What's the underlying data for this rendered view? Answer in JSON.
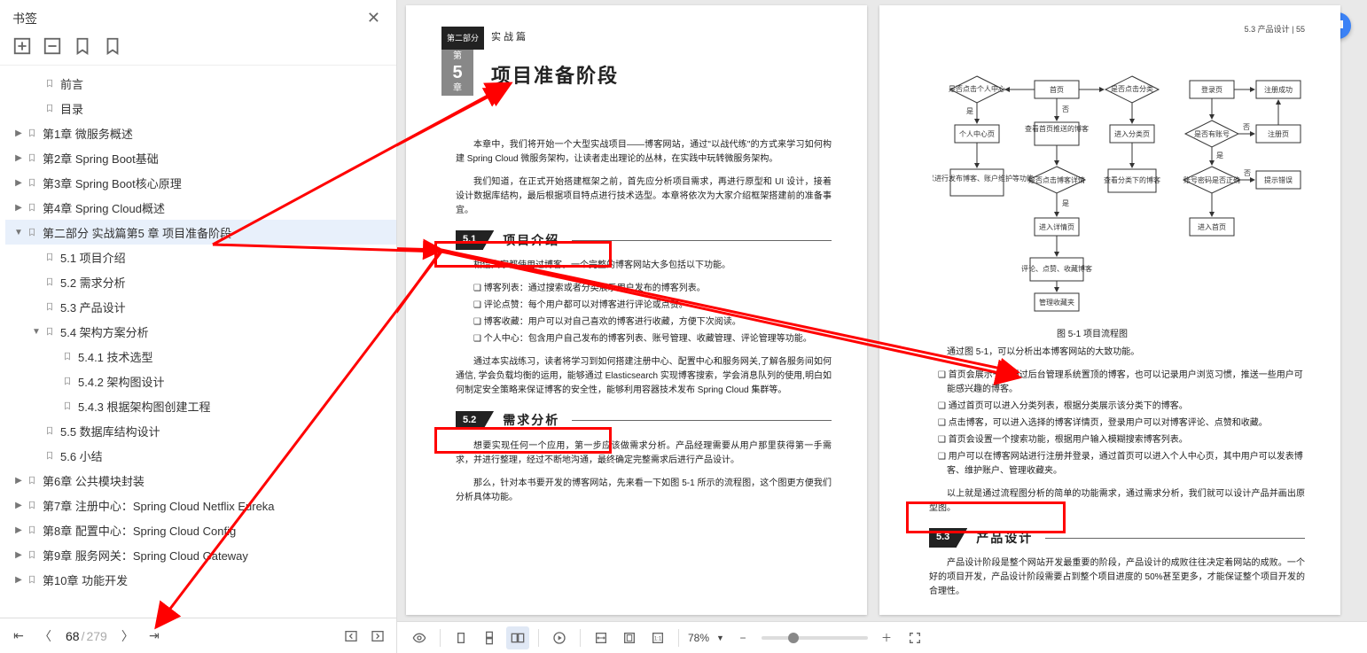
{
  "sidebar": {
    "title": "书签",
    "items": [
      {
        "label": "前言",
        "lvl": 1,
        "expand": null
      },
      {
        "label": "目录",
        "lvl": 1,
        "expand": null
      },
      {
        "label": "第1章 微服务概述",
        "lvl": 0,
        "expand": "▶"
      },
      {
        "label": "第2章 Spring Boot基础",
        "lvl": 0,
        "expand": "▶"
      },
      {
        "label": "第3章 Spring Boot核心原理",
        "lvl": 0,
        "expand": "▶"
      },
      {
        "label": "第4章 Spring Cloud概述",
        "lvl": 0,
        "expand": "▶"
      },
      {
        "label": "第二部分 实战篇第5 章 项目准备阶段",
        "lvl": 0,
        "expand": "▼",
        "sel": true
      },
      {
        "label": "5.1 项目介绍",
        "lvl": 1,
        "expand": null
      },
      {
        "label": "5.2 需求分析",
        "lvl": 1,
        "expand": null
      },
      {
        "label": "5.3 产品设计",
        "lvl": 1,
        "expand": null
      },
      {
        "label": "5.4 架构方案分析",
        "lvl": 1,
        "expand": "▼"
      },
      {
        "label": "5.4.1 技术选型",
        "lvl": 2,
        "expand": null
      },
      {
        "label": "5.4.2 架构图设计",
        "lvl": 2,
        "expand": null
      },
      {
        "label": "5.4.3 根据架构图创建工程",
        "lvl": 2,
        "expand": null
      },
      {
        "label": "5.5 数据库结构设计",
        "lvl": 1,
        "expand": null
      },
      {
        "label": "5.6 小结",
        "lvl": 1,
        "expand": null
      },
      {
        "label": "第6章 公共模块封装",
        "lvl": 0,
        "expand": "▶"
      },
      {
        "label": "第7章 注册中心：Spring Cloud Netflix Eureka",
        "lvl": 0,
        "expand": "▶"
      },
      {
        "label": "第8章 配置中心：Spring Cloud Config",
        "lvl": 0,
        "expand": "▶"
      },
      {
        "label": "第9章 服务网关：Spring Cloud Gateway",
        "lvl": 0,
        "expand": "▶"
      },
      {
        "label": "第10章 功能开发",
        "lvl": 0,
        "expand": "▶"
      }
    ]
  },
  "nav": {
    "current": "68",
    "sep": "/",
    "total": "279"
  },
  "pageL": {
    "part_tab": "第二部分",
    "part_label": "实战篇",
    "chap_top": "第",
    "chap_num": "5",
    "chap_bot": "章",
    "chap_title": "项目准备阶段",
    "p1": "本章中，我们将开始一个大型实战项目——博客网站，通过\"以战代练\"的方式来学习如何构建 Spring Cloud 微服务架构，让读者走出理论的丛林，在实践中玩转微服务架构。",
    "p2": "我们知道，在正式开始搭建框架之前，首先应分析项目需求，再进行原型和 UI 设计，接着设计数据库结构，最后根据项目特点进行技术选型。本章将依次为大家介绍框架搭建前的准备事宜。",
    "s51_num": "5.1",
    "s51_title": "项目介绍",
    "s51_p": "相信大家都使用过博客，一个完整的博客网站大多包括以下功能。",
    "s51_b1": "❑ 博客列表：通过搜索或者分类展示用户发布的博客列表。",
    "s51_b2": "❑ 评论点赞：每个用户都可以对博客进行评论或点赞。",
    "s51_b3": "❑ 博客收藏：用户可以对自己喜欢的博客进行收藏，方便下次阅读。",
    "s51_b4": "❑ 个人中心：包含用户自己发布的博客列表、账号管理、收藏管理、评论管理等功能。",
    "s51_p2": "通过本实战练习，读者将学习到如何搭建注册中心、配置中心和服务网关,了解各服务间如何通信, 学会负载均衡的运用，能够通过 Elasticsearch 实现博客搜索，学会消息队列的使用,明白如何制定安全策略来保证博客的安全性，能够利用容器技术发布 Spring Cloud 集群等。",
    "s52_num": "5.2",
    "s52_title": "需求分析",
    "s52_p1": "想要实现任何一个应用，第一步应该做需求分析。产品经理需要从用户那里获得第一手需求，并进行整理，经过不断地沟通，最终确定完整需求后进行产品设计。",
    "s52_p2": "那么，针对本书要开发的博客网站，先来看一下如图 5-1 所示的流程图，这个图更方便我们分析具体功能。"
  },
  "pageR": {
    "header": "5.3  产品设计     |     55",
    "fig_cap": "图 5-1  项目流程图",
    "fc": {
      "n1": "是否点击个人中心",
      "n2": "首页",
      "n3": "是否点击分类",
      "n4": "登录页",
      "n5": "注册成功",
      "n6": "个人中心页",
      "n7": "查看首页推送的博客",
      "n8": "进入分类页",
      "n9": "是否有账号",
      "n10": "注册页",
      "n11": "可以进行发布博客、账户维护等功能",
      "n12": "是否点击博客详情",
      "n13": "查看分类下的博客",
      "n14": "账号密码是否正确",
      "n15": "提示错误",
      "n16": "进入详情页",
      "n17": "进入首页",
      "n18": "评论、点赞、收藏博客",
      "n19": "管理收藏夹",
      "e_yes": "是",
      "e_no": "否"
    },
    "intro": "通过图 5-1，可以分析出本博客网站的大致功能。",
    "b1": "❑ 首页会展示一些通过后台管理系统置顶的博客，也可以记录用户浏览习惯，推送一些用户可能感兴趣的博客。",
    "b2": "❑ 通过首页可以进入分类列表，根据分类展示该分类下的博客。",
    "b3": "❑ 点击博客，可以进入选择的博客详情页，登录用户可以对博客评论、点赞和收藏。",
    "b4": "❑ 首页会设置一个搜索功能，根据用户输入模糊搜索博客列表。",
    "b5": "❑ 用户可以在博客网站进行注册并登录，通过首页可以进入个人中心页，其中用户可以发表博客、维护账户、管理收藏夹。",
    "concl": "以上就是通过流程图分析的简单的功能需求，通过需求分析，我们就可以设计产品并画出原型图。",
    "s53_num": "5.3",
    "s53_title": "产品设计",
    "s53_p": "产品设计阶段是整个网站开发最重要的阶段，产品设计的成败往往决定着网站的成败。一个好的项目开发，产品设计阶段需要占到整个项目进度的 50%甚至更多，才能保证整个项目开发的合理性。"
  },
  "bottombar": {
    "zoom": "78%"
  }
}
